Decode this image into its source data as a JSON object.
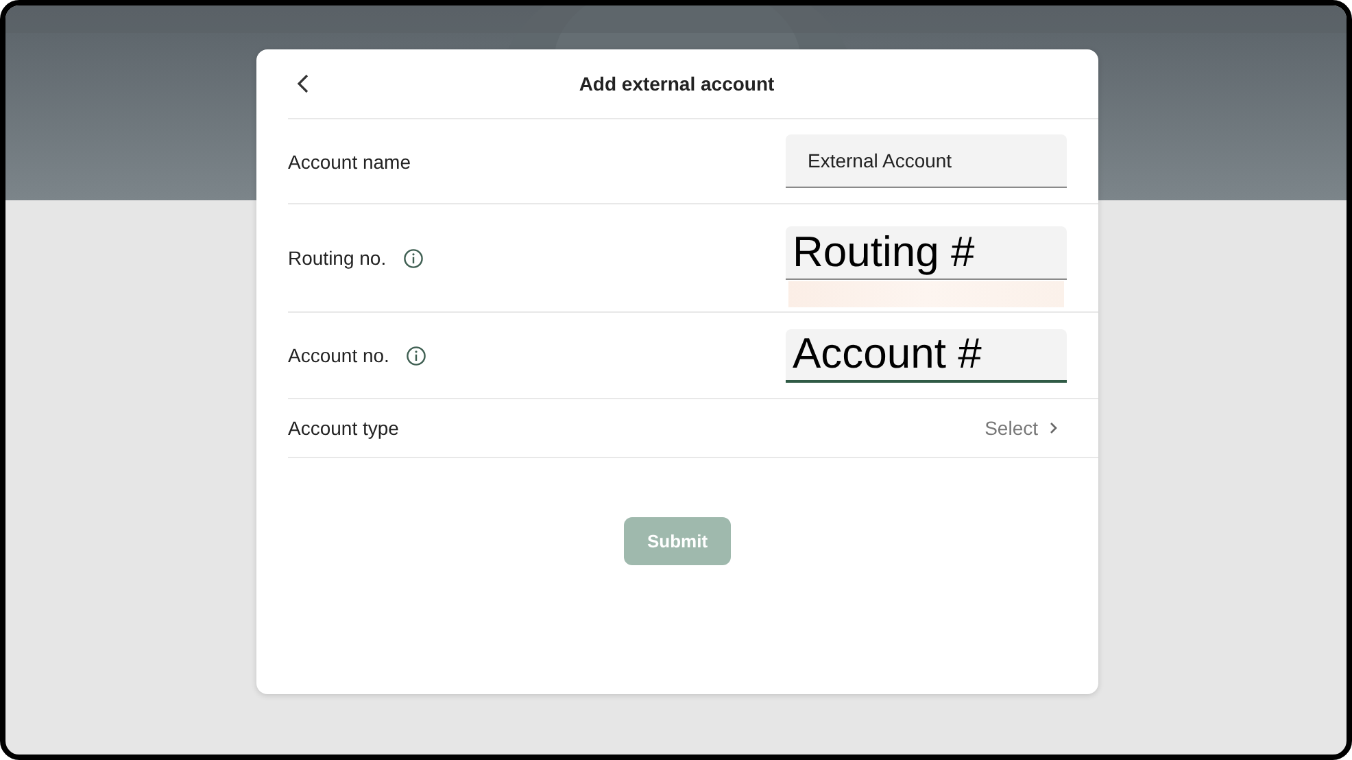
{
  "dialog": {
    "title": "Add external account"
  },
  "rows": [
    {
      "kind": "input",
      "label": "Account name",
      "info": false,
      "value": "External Account",
      "large": false,
      "focused": false,
      "autofill_strip": false
    },
    {
      "kind": "input",
      "label": "Routing no.",
      "info": true,
      "value": "Routing #",
      "large": true,
      "focused": false,
      "autofill_strip": true
    },
    {
      "kind": "input",
      "label": "Account no.",
      "info": true,
      "value": "Account #",
      "large": true,
      "focused": true,
      "autofill_strip": false
    },
    {
      "kind": "select",
      "label": "Account type",
      "info": false,
      "placeholder": "Select"
    }
  ],
  "submit": {
    "label": "Submit",
    "disabled": true
  }
}
